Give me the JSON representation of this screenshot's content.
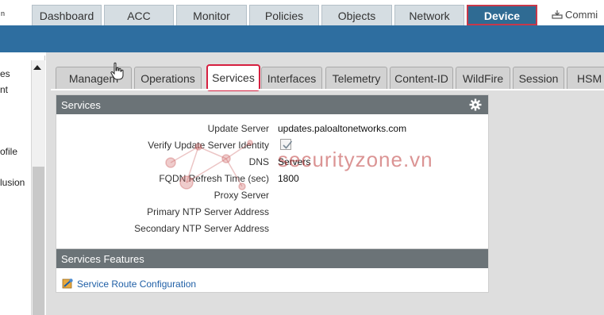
{
  "top_tabs": {
    "left_cut": "n",
    "items": [
      {
        "label": "Dashboard"
      },
      {
        "label": "ACC"
      },
      {
        "label": "Monitor"
      },
      {
        "label": "Policies"
      },
      {
        "label": "Objects"
      },
      {
        "label": "Network"
      },
      {
        "label": "Device",
        "active": true
      }
    ],
    "commit_label": "Commi"
  },
  "left_panel": {
    "items": [
      "es",
      "nt",
      "ofile",
      "lusion"
    ]
  },
  "sub_tabs": {
    "items": [
      {
        "label": "Managem"
      },
      {
        "label": "Operations"
      },
      {
        "label": "Services",
        "active": true
      },
      {
        "label": "Interfaces"
      },
      {
        "label": "Telemetry"
      },
      {
        "label": "Content-ID"
      },
      {
        "label": "WildFire"
      },
      {
        "label": "Session"
      },
      {
        "label": "HSM"
      }
    ]
  },
  "services_panel": {
    "title": "Services",
    "rows": [
      {
        "label": "Update Server",
        "value": "updates.paloaltonetworks.com"
      },
      {
        "label": "Verify Update Server Identity",
        "checked": true
      },
      {
        "label": "DNS",
        "value": "Servers"
      },
      {
        "label": "FQDN Refresh Time (sec)",
        "value": "1800"
      },
      {
        "label": "Proxy Server",
        "value": ""
      },
      {
        "label": "Primary NTP Server Address",
        "value": ""
      },
      {
        "label": "Secondary NTP Server Address",
        "value": ""
      }
    ]
  },
  "features_panel": {
    "title": "Services Features",
    "link": "Service Route Configuration"
  },
  "watermark": "securityzone.vn",
  "colors": {
    "active_tab_bg": "#2f6b93",
    "highlight_border": "#d62040",
    "header_bar": "#2e6ea0",
    "panel_head": "#6b7377",
    "link": "#1f5fa6"
  }
}
